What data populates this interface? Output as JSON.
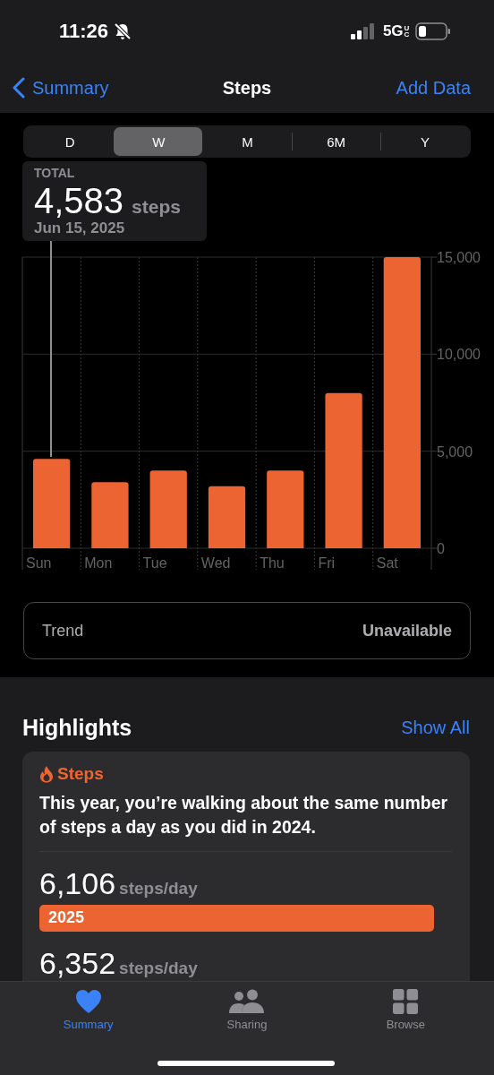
{
  "status_bar": {
    "time": "11:26",
    "network": "5G",
    "network_sub": "UC"
  },
  "nav": {
    "back": "Summary",
    "title": "Steps",
    "action": "Add Data"
  },
  "segments": [
    {
      "label": "D",
      "selected": false
    },
    {
      "label": "W",
      "selected": true
    },
    {
      "label": "M",
      "selected": false
    },
    {
      "label": "6M",
      "selected": false
    },
    {
      "label": "Y",
      "selected": false
    }
  ],
  "summary": {
    "label": "TOTAL",
    "value": "4,583",
    "unit": "steps",
    "date": "Jun 15, 2025"
  },
  "chart_data": {
    "type": "bar",
    "categories": [
      "Sun",
      "Mon",
      "Tue",
      "Wed",
      "Thu",
      "Fri",
      "Sat"
    ],
    "values": [
      4600,
      3400,
      4000,
      3200,
      4000,
      8000,
      15000
    ],
    "ylim": [
      0,
      15000
    ],
    "yticks": [
      {
        "value": 0,
        "label": "0"
      },
      {
        "value": 5000,
        "label": "5,000"
      },
      {
        "value": 10000,
        "label": "10,000"
      },
      {
        "value": 15000,
        "label": "15,000"
      }
    ]
  },
  "trend": {
    "label": "Trend",
    "value": "Unavailable"
  },
  "highlights": {
    "title": "Highlights",
    "action": "Show All",
    "card": {
      "category": "Steps",
      "text": "This year, you’re walking about the same number of steps a day as you did in 2024.",
      "comparisons": [
        {
          "value": "6,106",
          "unit": "steps/day",
          "year": "2025"
        },
        {
          "value": "6,352",
          "unit": "steps/day"
        }
      ]
    }
  },
  "tab_bar": [
    {
      "label": "Summary",
      "kind": "heart",
      "selected": true
    },
    {
      "label": "Sharing",
      "kind": "people",
      "selected": false
    },
    {
      "label": "Browse",
      "kind": "grid",
      "selected": false
    }
  ]
}
